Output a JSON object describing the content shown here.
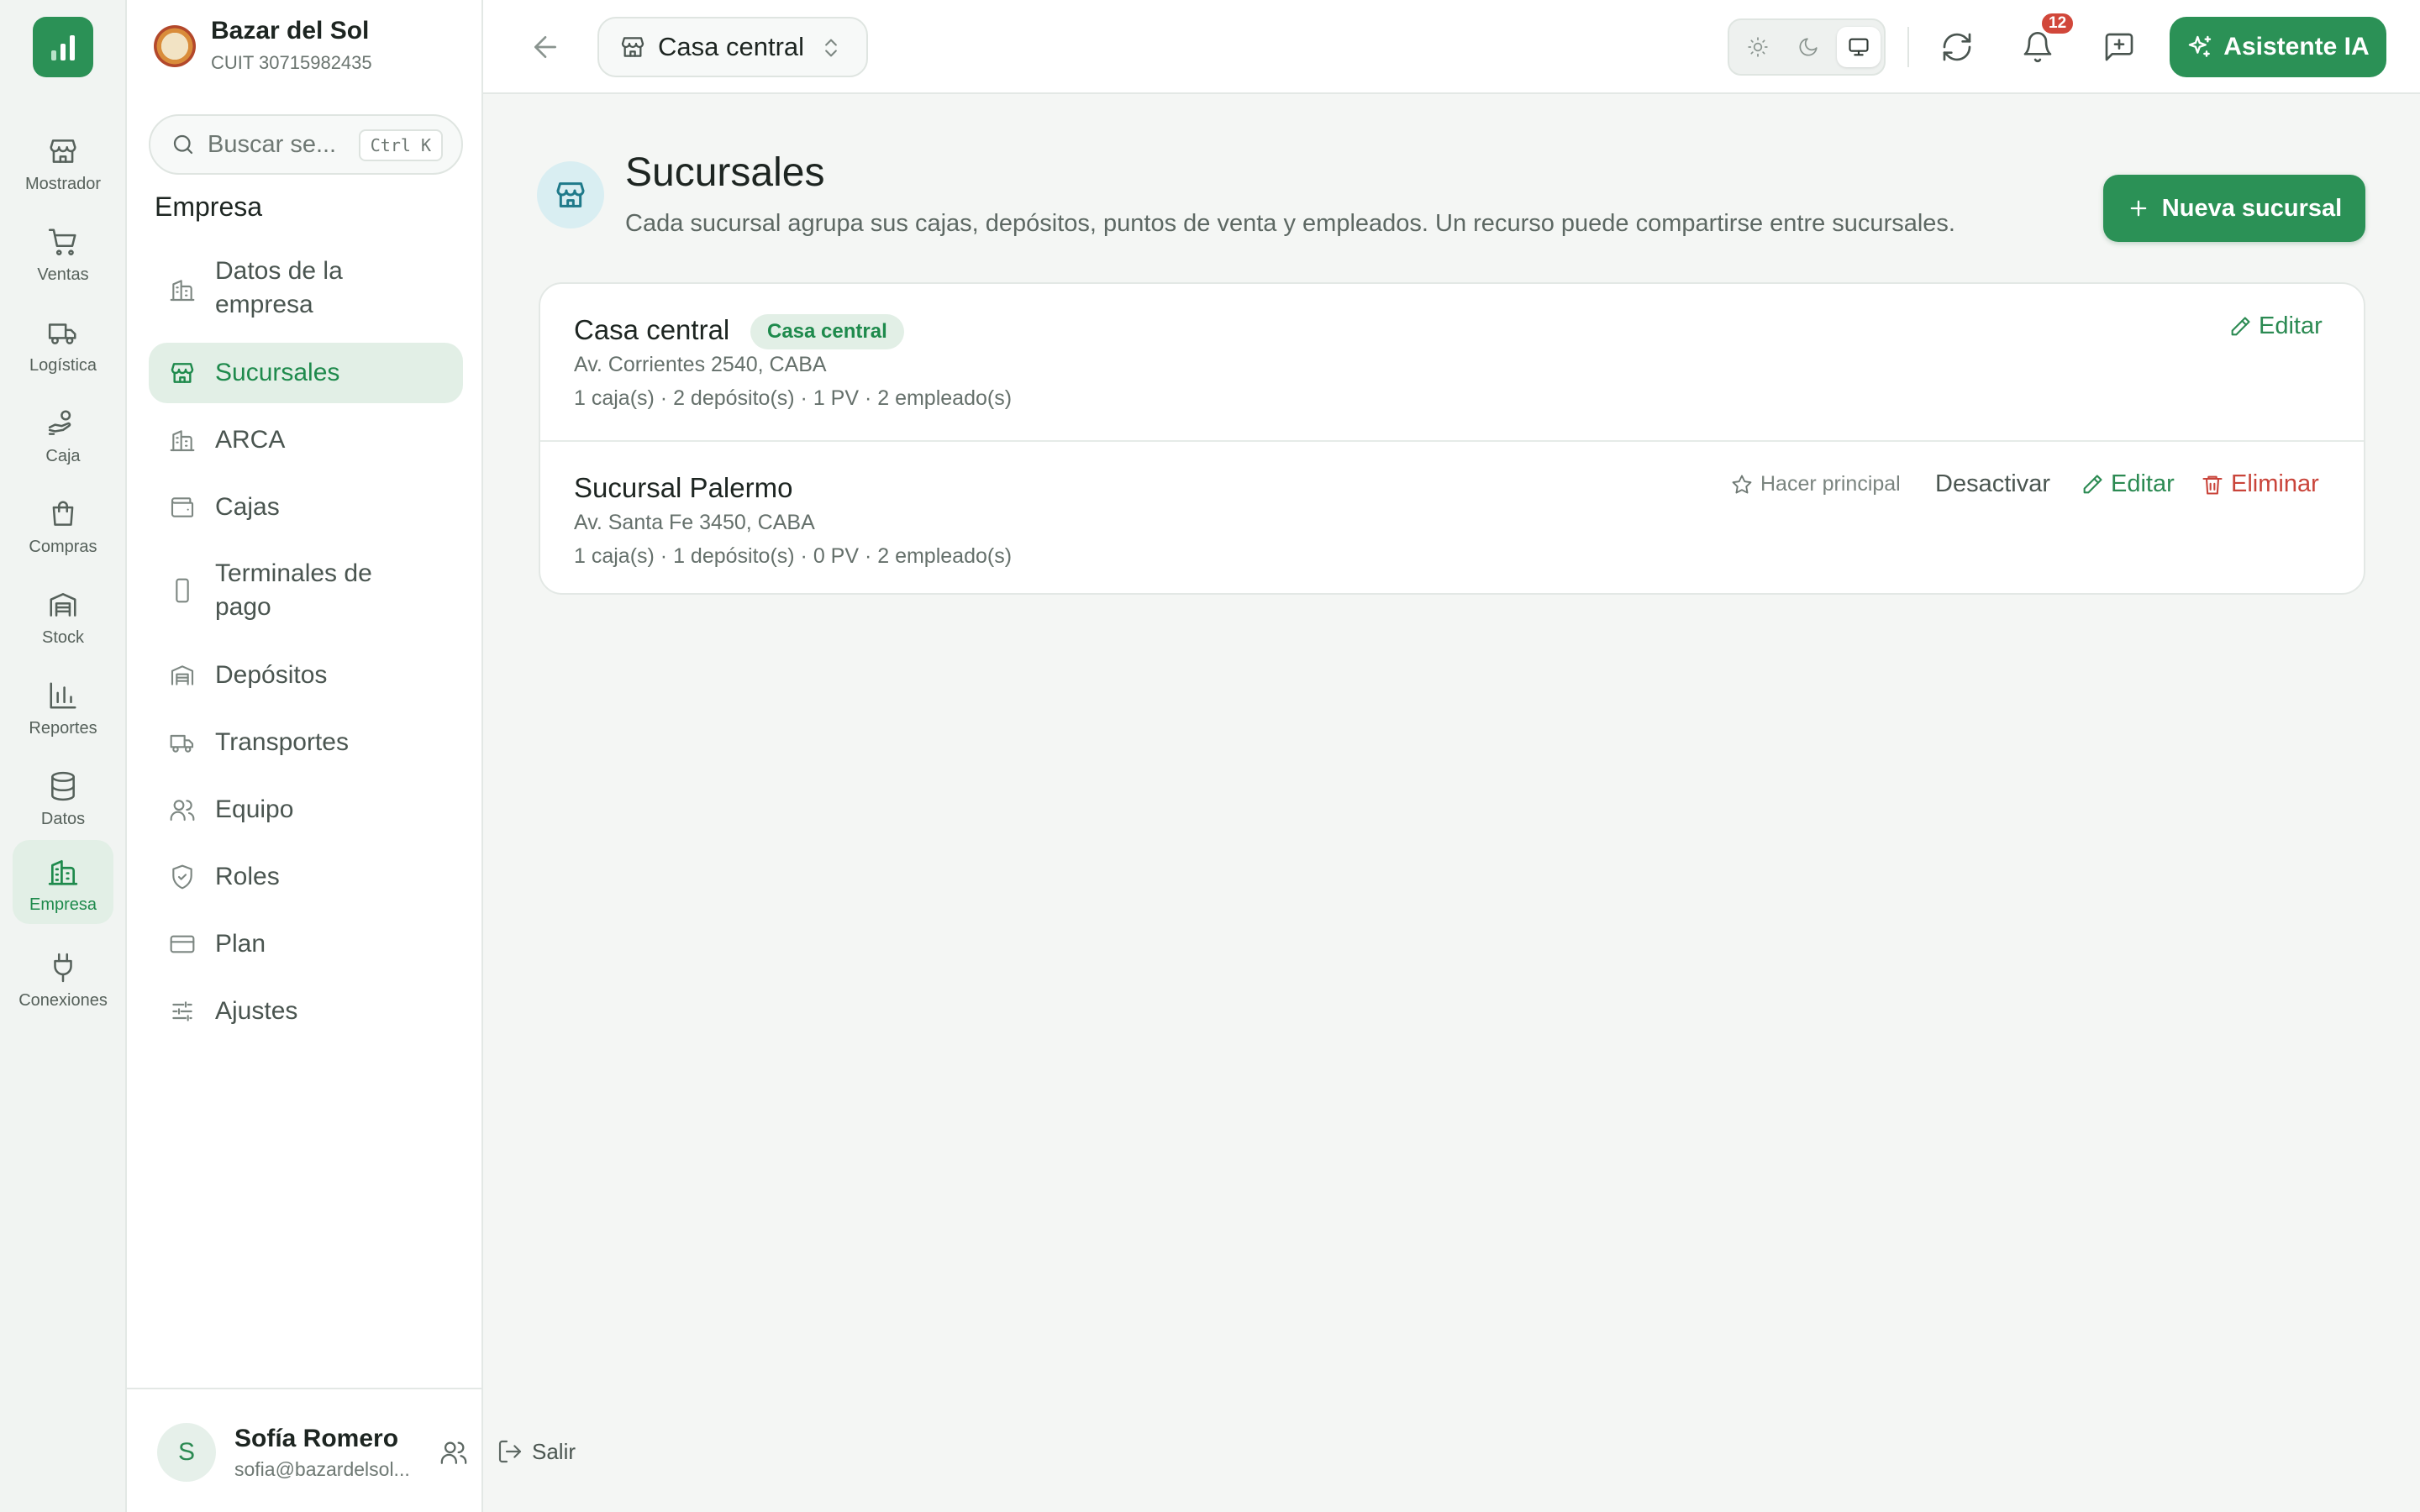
{
  "app": {
    "company_name": "Bazar del Sol",
    "company_cuit": "CUIT 30715982435"
  },
  "rail": {
    "items": [
      {
        "label": "Mostrador",
        "icon": "store-icon"
      },
      {
        "label": "Ventas",
        "icon": "cart-icon"
      },
      {
        "label": "Logística",
        "icon": "truck-icon"
      },
      {
        "label": "Caja",
        "icon": "cash-hand-icon"
      },
      {
        "label": "Compras",
        "icon": "shopping-bag-icon"
      },
      {
        "label": "Stock",
        "icon": "warehouse-icon"
      },
      {
        "label": "Reportes",
        "icon": "bar-chart-icon"
      },
      {
        "label": "Datos",
        "icon": "database-icon"
      },
      {
        "label": "Empresa",
        "icon": "building-icon",
        "active": true
      },
      {
        "label": "Conexiones",
        "icon": "plug-icon"
      }
    ]
  },
  "sidebar": {
    "search": {
      "placeholder": "Buscar se...",
      "shortcut": "Ctrl K"
    },
    "section_title": "Empresa",
    "items": [
      {
        "label": "Datos de la empresa",
        "icon": "building-icon"
      },
      {
        "label": "Sucursales",
        "icon": "store-icon",
        "active": true
      },
      {
        "label": "ARCA",
        "icon": "building-icon"
      },
      {
        "label": "Cajas",
        "icon": "wallet-icon"
      },
      {
        "label": "Terminales de pago",
        "icon": "smartphone-icon"
      },
      {
        "label": "Depósitos",
        "icon": "warehouse-icon"
      },
      {
        "label": "Transportes",
        "icon": "truck-icon"
      },
      {
        "label": "Equipo",
        "icon": "users-icon"
      },
      {
        "label": "Roles",
        "icon": "shield-check-icon"
      },
      {
        "label": "Plan",
        "icon": "credit-card-icon"
      },
      {
        "label": "Ajustes",
        "icon": "sliders-icon"
      }
    ],
    "user": {
      "initial": "S",
      "name": "Sofía Romero",
      "email": "sofia@bazardelsol...",
      "logout_label": "Salir"
    }
  },
  "topbar": {
    "branch_selector": "Casa central",
    "theme_options": [
      "light",
      "dark",
      "system"
    ],
    "theme_selected": "system",
    "notifications_count": "12",
    "ai_button": "Asistente IA"
  },
  "main": {
    "title": "Sucursales",
    "description": "Cada sucursal agrupa sus cajas, depósitos, puntos de venta y empleados. Un recurso puede compartirse entre sucursales.",
    "new_button": "Nueva sucursal",
    "branches": [
      {
        "name": "Casa central",
        "badge": "Casa central",
        "address": "Av. Corrientes 2540, CABA",
        "stats": "1 caja(s) · 2 depósito(s) · 1 PV · 2 empleado(s)",
        "actions": {
          "edit": "Editar"
        }
      },
      {
        "name": "Sucursal Palermo",
        "address": "Av. Santa Fe 3450, CABA",
        "stats": "1 caja(s) · 1 depósito(s) · 0 PV · 2 empleado(s)",
        "actions": {
          "make_main": "Hacer principal",
          "deactivate": "Desactivar",
          "edit": "Editar",
          "delete": "Eliminar"
        }
      }
    ]
  },
  "colors": {
    "accent": "#2b9156",
    "accent_text": "#1e8a4c",
    "active_bg": "#e2efe6",
    "danger": "#c9443a",
    "badge": "#d1473a"
  }
}
